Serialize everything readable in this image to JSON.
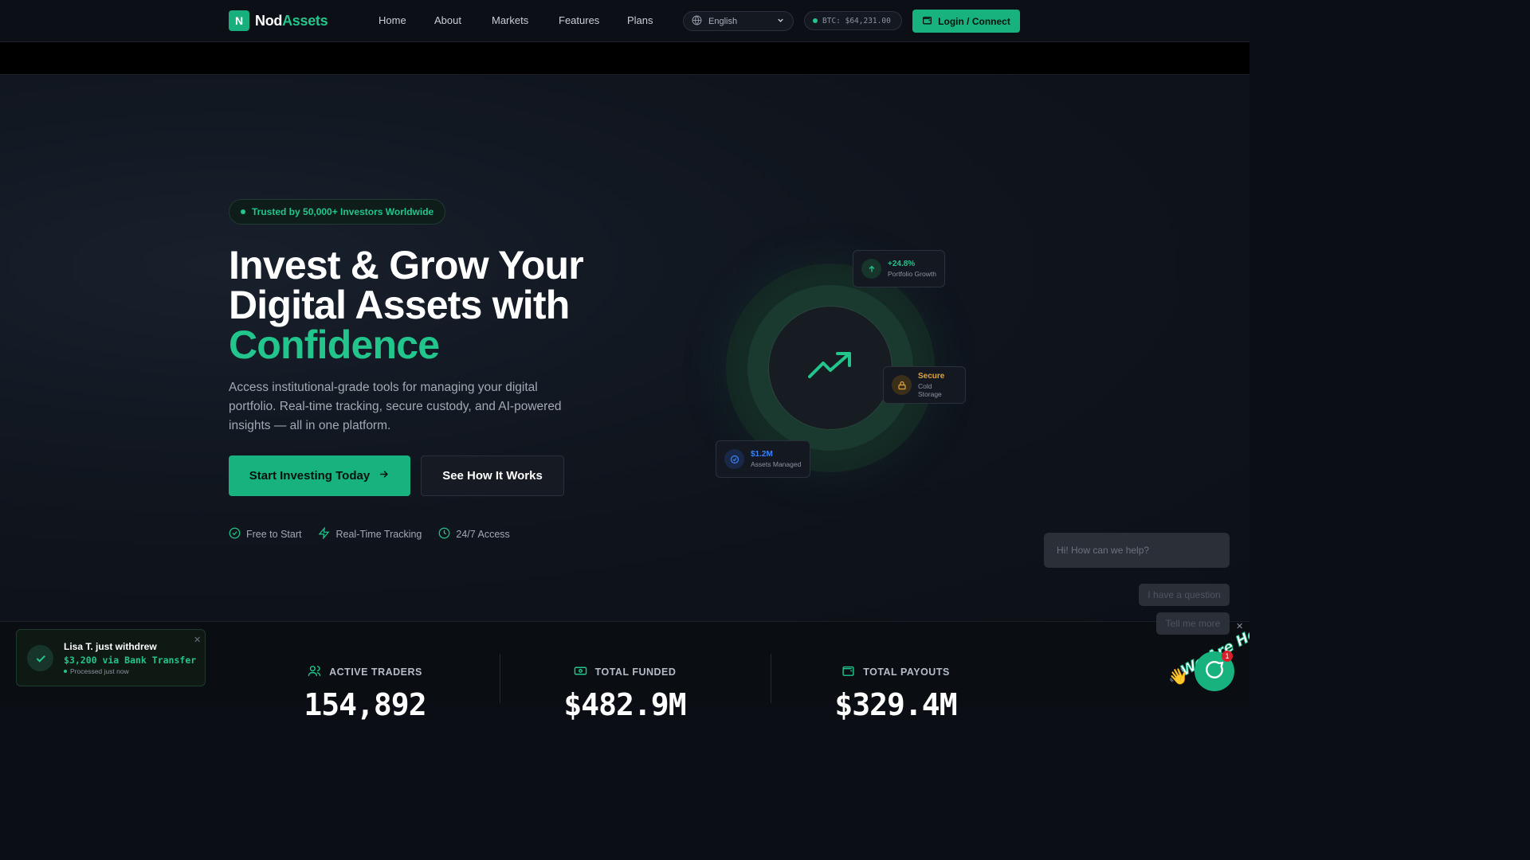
{
  "brand": {
    "badge": "N",
    "name_a": "Nod",
    "name_b": "Assets"
  },
  "nav": {
    "links": [
      "Home",
      "About",
      "Markets",
      "Features",
      "Plans"
    ],
    "language": "English",
    "btc_ticker": "BTC: $64,231.00",
    "login_label": "Login / Connect"
  },
  "hero": {
    "trust_badge": "Trusted by 50,000+ Investors Worldwide",
    "title_line1": "Invest & Grow Your",
    "title_line2": "Digital Assets with",
    "title_accent": "Confidence",
    "subtitle": "Access institutional-grade tools for managing your digital portfolio. Real-time tracking, secure custody, and AI-powered insights — all in one platform.",
    "cta_primary": "Start Investing Today",
    "cta_secondary": "See How It Works",
    "features": [
      "Free to Start",
      "Real-Time Tracking",
      "24/7 Access"
    ]
  },
  "visual": {
    "growth": {
      "value": "+24.8%",
      "label": "Portfolio Growth"
    },
    "secure": {
      "value": "Secure",
      "label": "Cold Storage"
    },
    "assets": {
      "value": "$1.2M",
      "label": "Assets Managed"
    }
  },
  "chat": {
    "greeting": "Hi! How can we help?",
    "option1": "I have a question",
    "option2": "Tell me more",
    "badge_count": "1",
    "logo_text": "We Are Here!"
  },
  "stats": [
    {
      "label": "ACTIVE TRADERS",
      "value": "154,892"
    },
    {
      "label": "TOTAL FUNDED",
      "value": "$482.9M"
    },
    {
      "label": "TOTAL PAYOUTS",
      "value": "$329.4M"
    }
  ],
  "toast": {
    "title": "Lisa T. just withdrew",
    "amount": "$3,200 via Bank Transfer",
    "status": "Processed just now"
  },
  "colors": {
    "accent": "#22c58b",
    "button": "#18b27f",
    "secure": "#e0a43a",
    "assets": "#3b82f6"
  }
}
